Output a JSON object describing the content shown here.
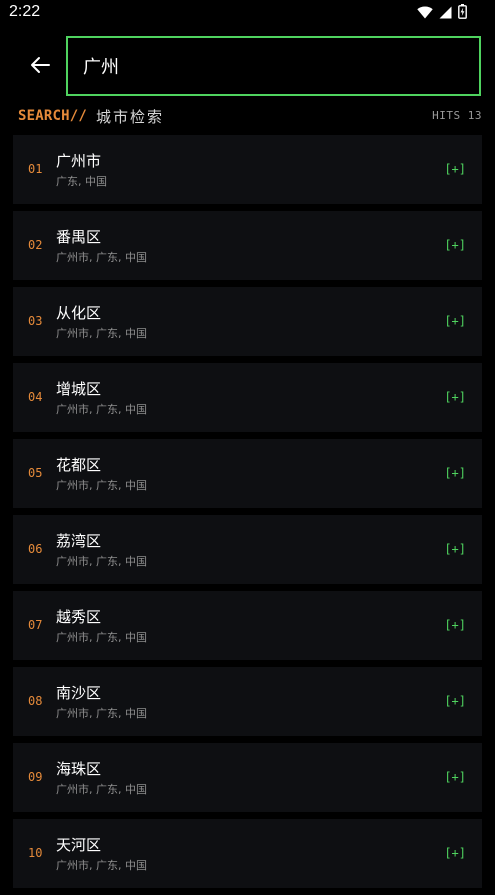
{
  "status_bar": {
    "time": "2:22",
    "icons": [
      "wifi-icon",
      "cellular-signal-icon",
      "battery-charging-icon"
    ]
  },
  "colors": {
    "accent_green": "#4fd35f",
    "accent_orange": "#e58a3a",
    "row_background": "#0e0f12",
    "page_background": "#000000"
  },
  "header": {
    "back_icon": "arrow-left-icon",
    "search_value": "广州"
  },
  "section": {
    "tag": "SEARCH//",
    "title": "城市检索",
    "hits_label": "HITS 13"
  },
  "results": [
    {
      "index": "01",
      "name": "广州市",
      "subtitle": "广东, 中国",
      "action": "[+]"
    },
    {
      "index": "02",
      "name": "番禺区",
      "subtitle": "广州市, 广东, 中国",
      "action": "[+]"
    },
    {
      "index": "03",
      "name": "从化区",
      "subtitle": "广州市, 广东, 中国",
      "action": "[+]"
    },
    {
      "index": "04",
      "name": "增城区",
      "subtitle": "广州市, 广东, 中国",
      "action": "[+]"
    },
    {
      "index": "05",
      "name": "花都区",
      "subtitle": "广州市, 广东, 中国",
      "action": "[+]"
    },
    {
      "index": "06",
      "name": "荔湾区",
      "subtitle": "广州市, 广东, 中国",
      "action": "[+]"
    },
    {
      "index": "07",
      "name": "越秀区",
      "subtitle": "广州市, 广东, 中国",
      "action": "[+]"
    },
    {
      "index": "08",
      "name": "南沙区",
      "subtitle": "广州市, 广东, 中国",
      "action": "[+]"
    },
    {
      "index": "09",
      "name": "海珠区",
      "subtitle": "广州市, 广东, 中国",
      "action": "[+]"
    },
    {
      "index": "10",
      "name": "天河区",
      "subtitle": "广州市, 广东, 中国",
      "action": "[+]"
    }
  ]
}
